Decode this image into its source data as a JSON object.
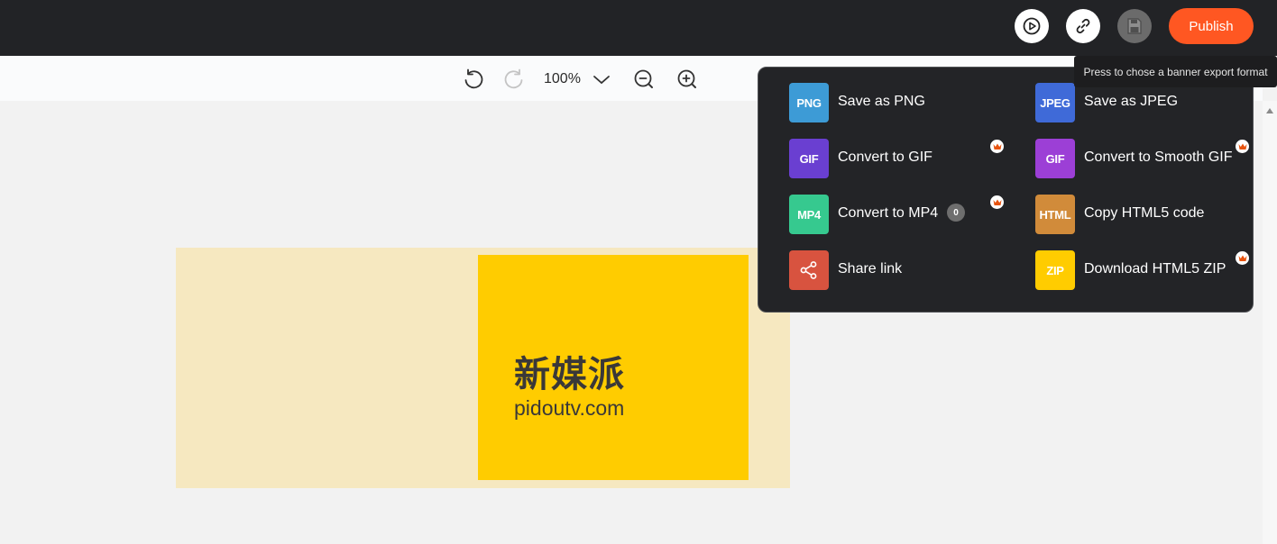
{
  "topbar": {
    "publish_label": "Publish",
    "tooltip": "Press to chose a banner export format",
    "icons": [
      "preview-play-icon",
      "link-icon",
      "save-icon"
    ]
  },
  "toolbar": {
    "zoom": "100%",
    "icons": [
      "undo-icon",
      "redo-icon",
      "zoom-dropdown-icon",
      "zoom-out-icon",
      "zoom-in-icon"
    ]
  },
  "banner": {
    "title": "新媒派",
    "subtitle": "pidoutv.com"
  },
  "export_menu": {
    "items": [
      {
        "tag": "PNG",
        "label": "Save as PNG",
        "color": "#3d9bd6"
      },
      {
        "tag": "JPEG",
        "label": "Save as JPEG",
        "color": "#3f6ad8"
      },
      {
        "tag": "GIF",
        "label": "Convert to GIF",
        "color": "#6a3fd1"
      },
      {
        "tag": "GIF",
        "label": "Convert to Smooth GIF",
        "color": "#9c3fd6"
      },
      {
        "tag": "MP4",
        "label": "Convert to MP4",
        "color": "#36c98f",
        "badge": "0"
      },
      {
        "tag": "HTML",
        "label": "Copy HTML5 code",
        "color": "#d18b3a"
      },
      {
        "tag": "",
        "label": "Share link",
        "color": "#d8533f",
        "icon": "share-icon"
      },
      {
        "tag": "ZIP",
        "label": "Download HTML5 ZIP",
        "color": "#ffcc00"
      }
    ],
    "premium_icon": "crown-icon"
  },
  "colors": {
    "topbar": "#222326",
    "publish": "#ff5722",
    "menu_bg": "#232427",
    "banner_bg": "#f6e8c0",
    "banner_card": "#ffcc00"
  }
}
